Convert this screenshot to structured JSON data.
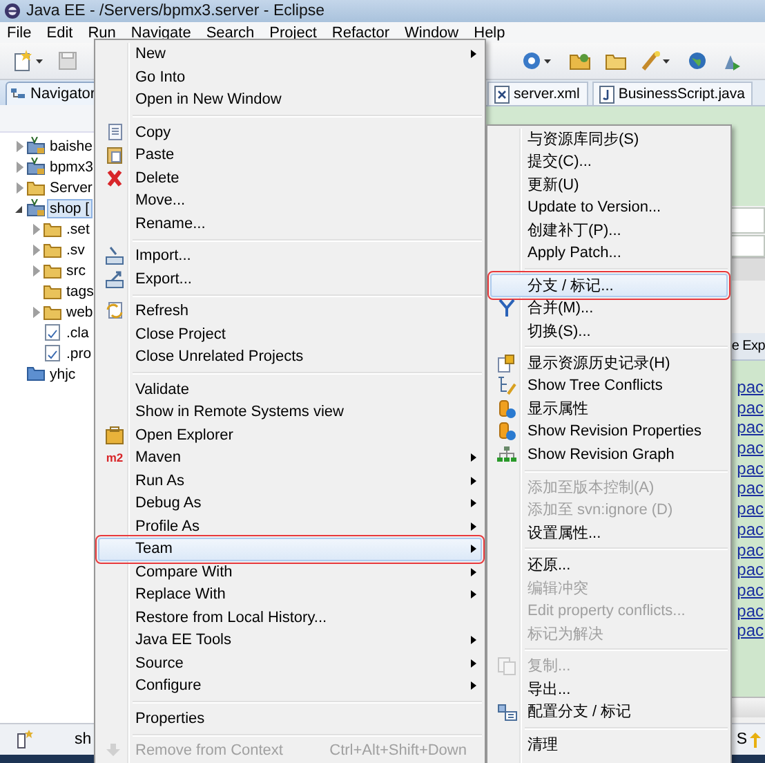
{
  "window": {
    "title": "Java EE - /Servers/bpmx3.server - Eclipse"
  },
  "menu_bar": [
    "File",
    "Edit",
    "Run",
    "Navigate",
    "Search",
    "Project",
    "Refactor",
    "Window",
    "Help"
  ],
  "navigator": {
    "title": "Navigator",
    "tree": [
      {
        "label": "baishe",
        "kind": "project",
        "expandable": true,
        "expanded": false,
        "selected": false
      },
      {
        "label": "bpmx3",
        "kind": "project",
        "expandable": true,
        "expanded": false,
        "selected": false
      },
      {
        "label": "Server",
        "kind": "folder",
        "expandable": true,
        "expanded": false,
        "selected": false
      },
      {
        "label": "shop [",
        "kind": "project",
        "expandable": true,
        "expanded": true,
        "selected": true,
        "children": [
          {
            "label": ".set",
            "kind": "folder",
            "expandable": true,
            "expanded": false,
            "selected": false
          },
          {
            "label": ".sv",
            "kind": "folder",
            "expandable": true,
            "expanded": false,
            "selected": false
          },
          {
            "label": "src",
            "kind": "folder",
            "expandable": true,
            "expanded": false,
            "selected": false
          },
          {
            "label": "tags",
            "kind": "folder",
            "expandable": false,
            "selected": false
          },
          {
            "label": "web",
            "kind": "folder",
            "expandable": true,
            "expanded": false,
            "selected": false
          },
          {
            "label": ".cla",
            "kind": "file",
            "expandable": false,
            "selected": false
          },
          {
            "label": ".pro",
            "kind": "file",
            "expandable": false,
            "selected": false
          }
        ]
      },
      {
        "label": "yhjc",
        "kind": "closed-project",
        "expandable": false,
        "selected": false
      }
    ]
  },
  "editor_tabs": [
    {
      "label": "server.xml",
      "kind": "xml"
    },
    {
      "label": "BusinessScript.java",
      "kind": "java"
    }
  ],
  "side_view": {
    "tab": "e Exp",
    "links": [
      "pac",
      "pac",
      "pac",
      "pac",
      "pac",
      "pac",
      "pac",
      "pac",
      "pac",
      "pac",
      "pac",
      "pac",
      "pac"
    ]
  },
  "status_bar": {
    "text": "sh",
    "right": "S"
  },
  "context_menu": {
    "items": [
      {
        "kind": "item",
        "label": "New",
        "submenu": true,
        "disabled": false,
        "selected": false
      },
      {
        "kind": "item",
        "label": "Go Into",
        "submenu": false,
        "disabled": false,
        "selected": false
      },
      {
        "kind": "item",
        "label": "Open in New Window",
        "submenu": false,
        "disabled": false,
        "selected": false
      },
      {
        "kind": "separator"
      },
      {
        "kind": "item",
        "label": "Copy",
        "submenu": false,
        "disabled": false,
        "selected": false
      },
      {
        "kind": "item",
        "label": "Paste",
        "submenu": false,
        "disabled": false,
        "selected": false
      },
      {
        "kind": "item",
        "label": "Delete",
        "submenu": false,
        "disabled": false,
        "selected": false
      },
      {
        "kind": "item",
        "label": "Move...",
        "submenu": false,
        "disabled": false,
        "selected": false
      },
      {
        "kind": "item",
        "label": "Rename...",
        "submenu": false,
        "disabled": false,
        "selected": false
      },
      {
        "kind": "separator"
      },
      {
        "kind": "item",
        "label": "Import...",
        "submenu": false,
        "disabled": false,
        "selected": false
      },
      {
        "kind": "item",
        "label": "Export...",
        "submenu": false,
        "disabled": false,
        "selected": false
      },
      {
        "kind": "separator"
      },
      {
        "kind": "item",
        "label": "Refresh",
        "submenu": false,
        "disabled": false,
        "selected": false
      },
      {
        "kind": "item",
        "label": "Close Project",
        "submenu": false,
        "disabled": false,
        "selected": false
      },
      {
        "kind": "item",
        "label": "Close Unrelated Projects",
        "submenu": false,
        "disabled": false,
        "selected": false
      },
      {
        "kind": "separator"
      },
      {
        "kind": "item",
        "label": "Validate",
        "submenu": false,
        "disabled": false,
        "selected": false
      },
      {
        "kind": "item",
        "label": "Show in Remote Systems view",
        "submenu": false,
        "disabled": false,
        "selected": false
      },
      {
        "kind": "item",
        "label": "Open Explorer",
        "submenu": false,
        "disabled": false,
        "selected": false
      },
      {
        "kind": "item",
        "label": "Maven",
        "badge": "m2",
        "submenu": true,
        "disabled": false,
        "selected": false
      },
      {
        "kind": "item",
        "label": "Run As",
        "submenu": true,
        "disabled": false,
        "selected": false
      },
      {
        "kind": "item",
        "label": "Debug As",
        "submenu": true,
        "disabled": false,
        "selected": false
      },
      {
        "kind": "item",
        "label": "Profile As",
        "submenu": true,
        "disabled": false,
        "selected": false
      },
      {
        "kind": "item",
        "label": "Team",
        "submenu": true,
        "disabled": false,
        "selected": true
      },
      {
        "kind": "item",
        "label": "Compare With",
        "submenu": true,
        "disabled": false,
        "selected": false
      },
      {
        "kind": "item",
        "label": "Replace With",
        "submenu": true,
        "disabled": false,
        "selected": false
      },
      {
        "kind": "item",
        "label": "Restore from Local History...",
        "submenu": false,
        "disabled": false,
        "selected": false
      },
      {
        "kind": "item",
        "label": "Java EE Tools",
        "submenu": true,
        "disabled": false,
        "selected": false
      },
      {
        "kind": "item",
        "label": "Source",
        "submenu": true,
        "disabled": false,
        "selected": false
      },
      {
        "kind": "item",
        "label": "Configure",
        "submenu": true,
        "disabled": false,
        "selected": false
      },
      {
        "kind": "separator"
      },
      {
        "kind": "item",
        "label": "Properties",
        "submenu": false,
        "disabled": false,
        "selected": false
      },
      {
        "kind": "separator"
      },
      {
        "kind": "item",
        "label": "Remove from Context",
        "shortcut": "Ctrl+Alt+Shift+Down",
        "submenu": false,
        "disabled": true,
        "selected": false
      }
    ]
  },
  "team_menu": {
    "items": [
      {
        "kind": "item",
        "label": "与资源库同步(S)",
        "disabled": false,
        "selected": false
      },
      {
        "kind": "item",
        "label": "提交(C)...",
        "disabled": false,
        "selected": false
      },
      {
        "kind": "item",
        "label": "更新(U)",
        "disabled": false,
        "selected": false
      },
      {
        "kind": "item",
        "label": "Update to Version...",
        "disabled": false,
        "selected": false
      },
      {
        "kind": "item",
        "label": "创建补丁(P)...",
        "disabled": false,
        "selected": false
      },
      {
        "kind": "item",
        "label": "Apply Patch...",
        "disabled": false,
        "selected": false
      },
      {
        "kind": "separator"
      },
      {
        "kind": "item",
        "label": "分支 / 标记...",
        "disabled": false,
        "selected": true
      },
      {
        "kind": "item",
        "label": "合并(M)...",
        "disabled": false,
        "selected": false
      },
      {
        "kind": "item",
        "label": "切换(S)...",
        "disabled": false,
        "selected": false
      },
      {
        "kind": "separator"
      },
      {
        "kind": "item",
        "label": "显示资源历史记录(H)",
        "disabled": false,
        "selected": false
      },
      {
        "kind": "item",
        "label": "Show Tree Conflicts",
        "disabled": false,
        "selected": false
      },
      {
        "kind": "item",
        "label": "显示属性",
        "disabled": false,
        "selected": false
      },
      {
        "kind": "item",
        "label": "Show Revision Properties",
        "disabled": false,
        "selected": false
      },
      {
        "kind": "item",
        "label": "Show Revision Graph",
        "disabled": false,
        "selected": false
      },
      {
        "kind": "separator"
      },
      {
        "kind": "item",
        "label": "添加至版本控制(A)",
        "disabled": true,
        "selected": false
      },
      {
        "kind": "item",
        "label": "添加至 svn:ignore (D)",
        "disabled": true,
        "selected": false
      },
      {
        "kind": "item",
        "label": "设置属性...",
        "disabled": false,
        "selected": false
      },
      {
        "kind": "separator"
      },
      {
        "kind": "item",
        "label": "还原...",
        "disabled": false,
        "selected": false
      },
      {
        "kind": "item",
        "label": "编辑冲突",
        "disabled": true,
        "selected": false
      },
      {
        "kind": "item",
        "label": "Edit property conflicts...",
        "disabled": true,
        "selected": false
      },
      {
        "kind": "item",
        "label": "标记为解决",
        "disabled": true,
        "selected": false
      },
      {
        "kind": "separator"
      },
      {
        "kind": "item",
        "label": "复制...",
        "disabled": true,
        "selected": false
      },
      {
        "kind": "item",
        "label": "导出...",
        "disabled": false,
        "selected": false
      },
      {
        "kind": "item",
        "label": "配置分支 / 标记",
        "disabled": false,
        "selected": false
      },
      {
        "kind": "separator"
      },
      {
        "kind": "item",
        "label": "清理",
        "disabled": false,
        "selected": false
      }
    ]
  }
}
